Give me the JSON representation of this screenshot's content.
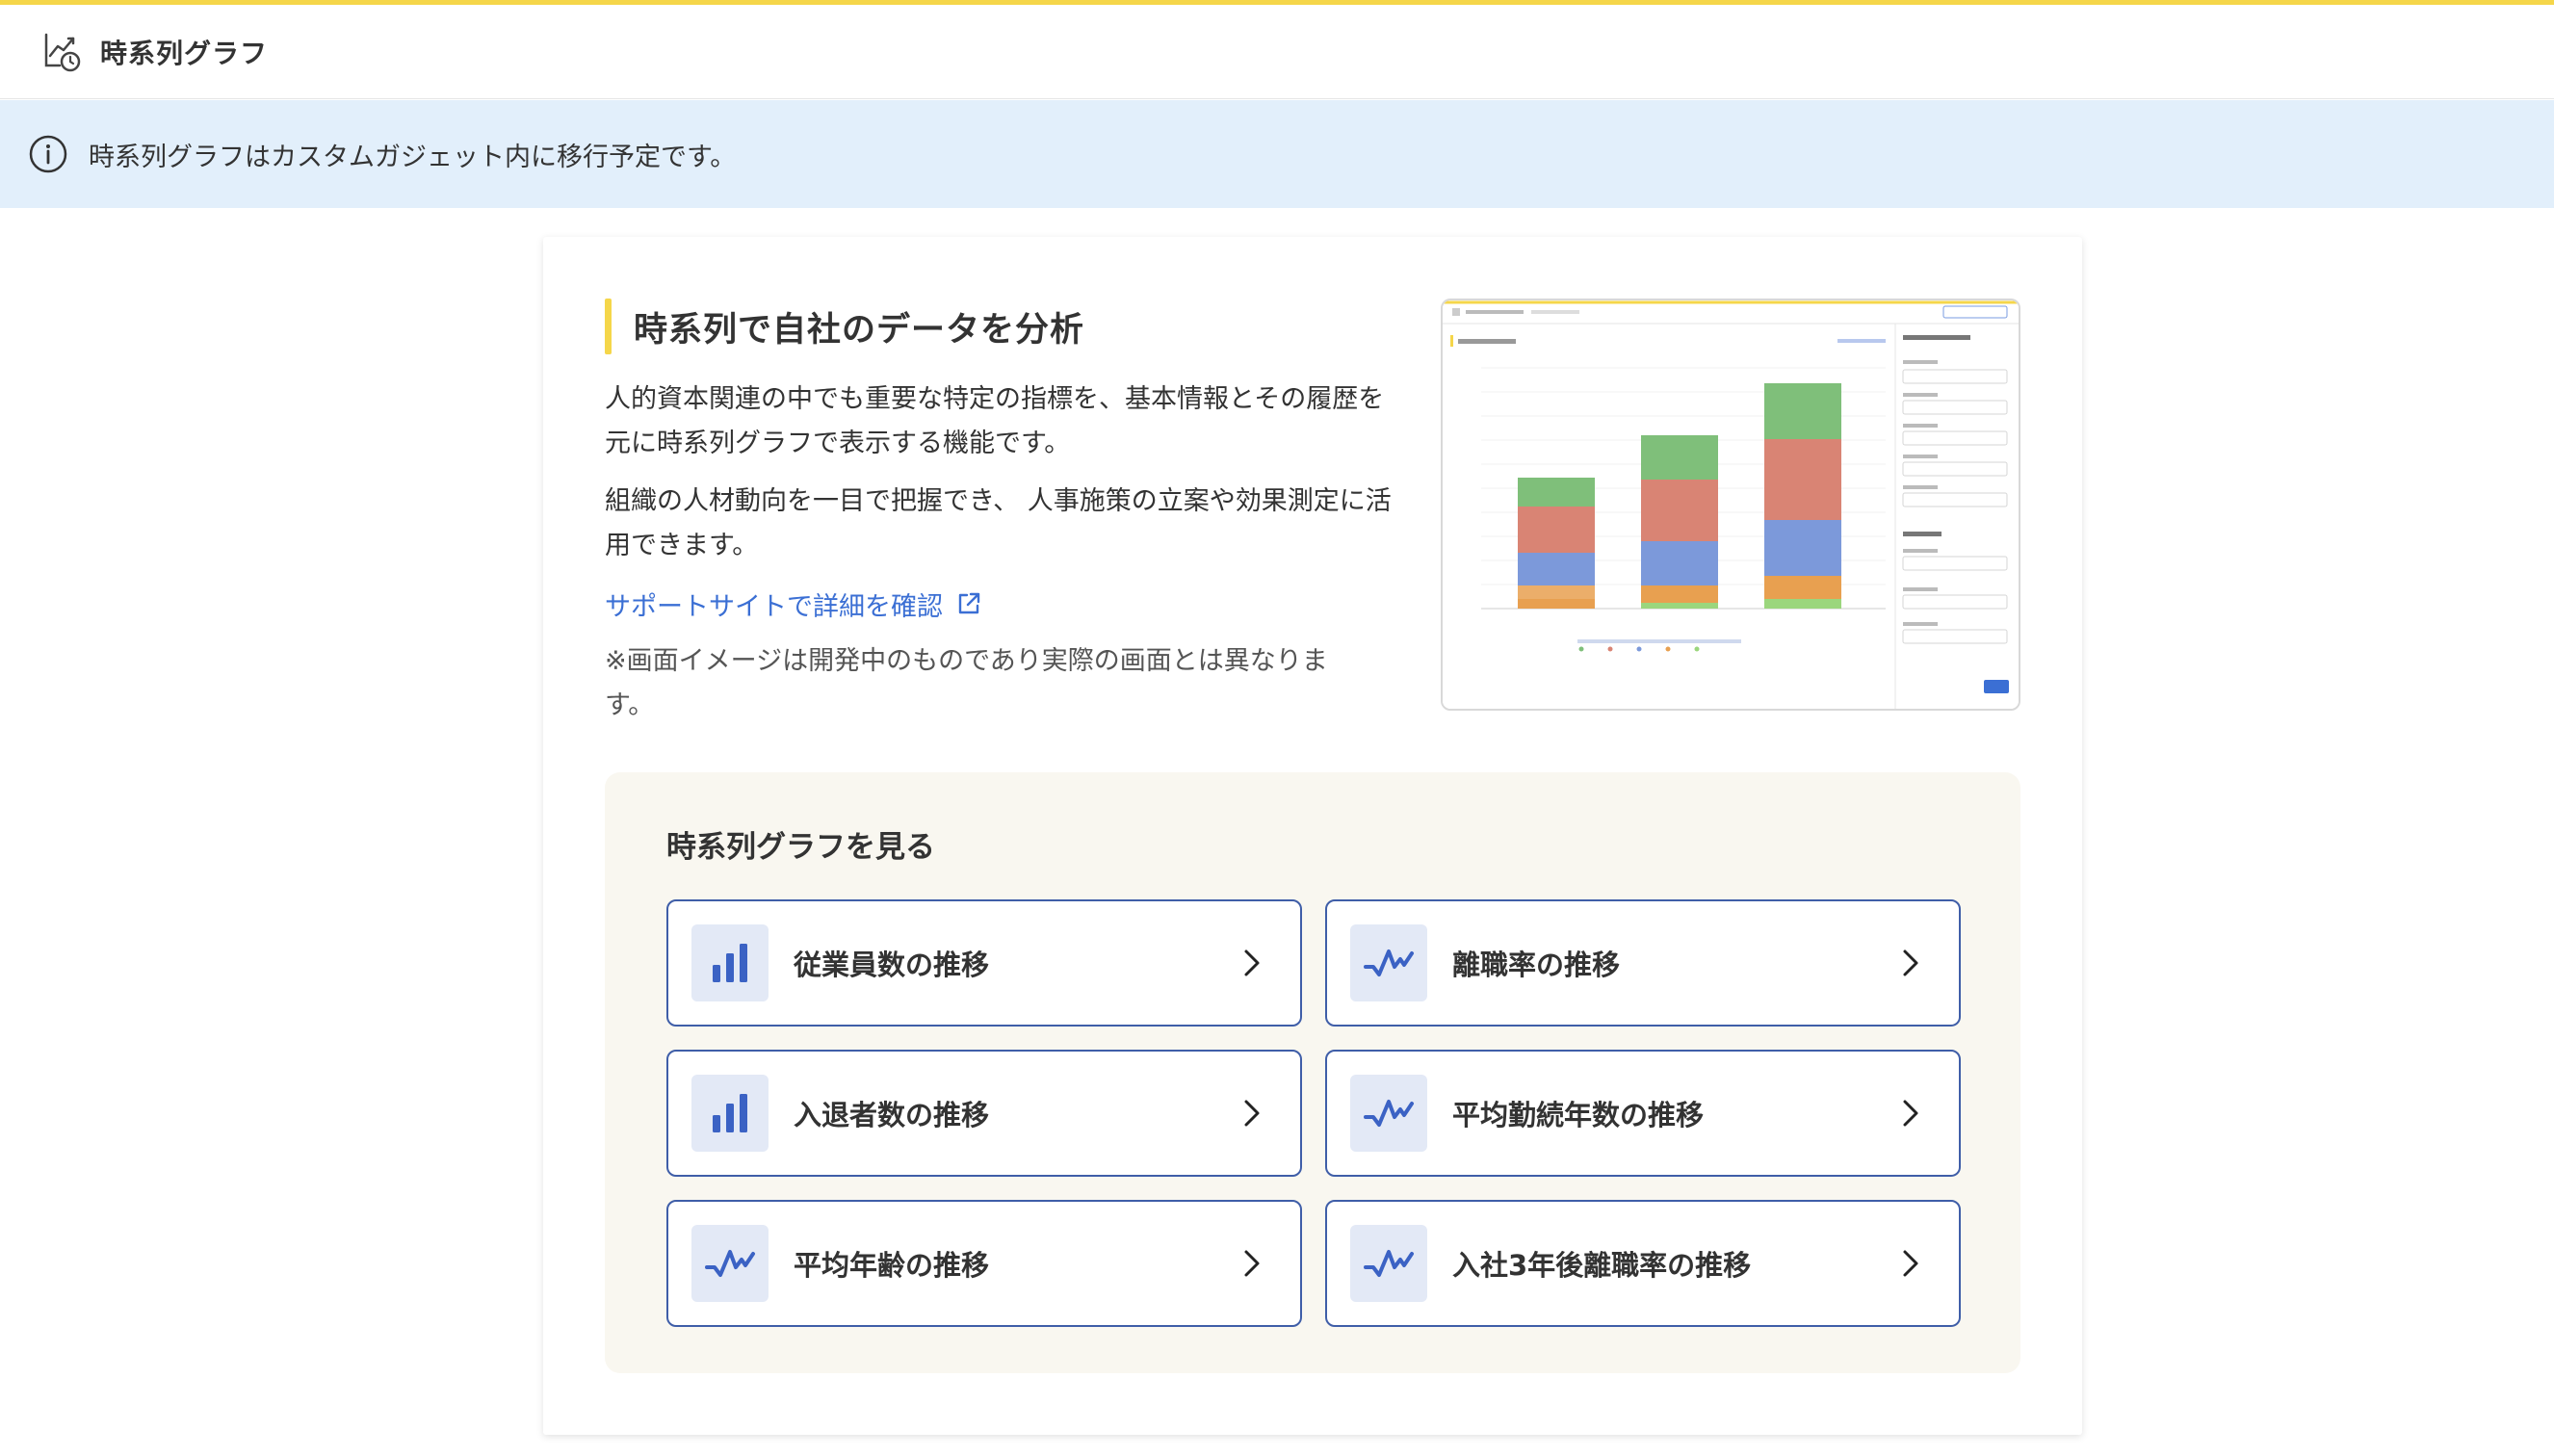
{
  "header": {
    "title": "時系列グラフ",
    "icon": "chart-history-icon"
  },
  "banner": {
    "icon": "info-icon",
    "text": "時系列グラフはカスタムガジェット内に移行予定です。"
  },
  "intro": {
    "heading": "時系列で自社のデータを分析",
    "paragraph1": "人的資本関連の中でも重要な特定の指標を、基本情報とその履歴を元に時系列グラフで表示する機能です。",
    "paragraph2": "組織の人材動向を一目で把握でき、 人事施策の立案や効果測定に活用できます。",
    "support_link": "サポートサイトで詳細を確認",
    "note": "※画面イメージは開発中のものであり実際の画面とは異なります。"
  },
  "panel": {
    "title": "時系列グラフを見る",
    "buttons": [
      {
        "label": "従業員数の推移",
        "icon": "bar-chart-icon"
      },
      {
        "label": "離職率の推移",
        "icon": "line-chart-icon"
      },
      {
        "label": "入退者数の推移",
        "icon": "bar-chart-icon"
      },
      {
        "label": "平均勤続年数の推移",
        "icon": "line-chart-icon"
      },
      {
        "label": "平均年齢の推移",
        "icon": "line-chart-icon"
      },
      {
        "label": "入社3年後離職率の推移",
        "icon": "line-chart-icon"
      }
    ]
  },
  "colors": {
    "accent_yellow": "#f5d64a",
    "banner_bg": "#e2effb",
    "link_blue": "#3b6fd4",
    "button_border": "#3f5ea8",
    "panel_bg": "#f9f7f0"
  }
}
